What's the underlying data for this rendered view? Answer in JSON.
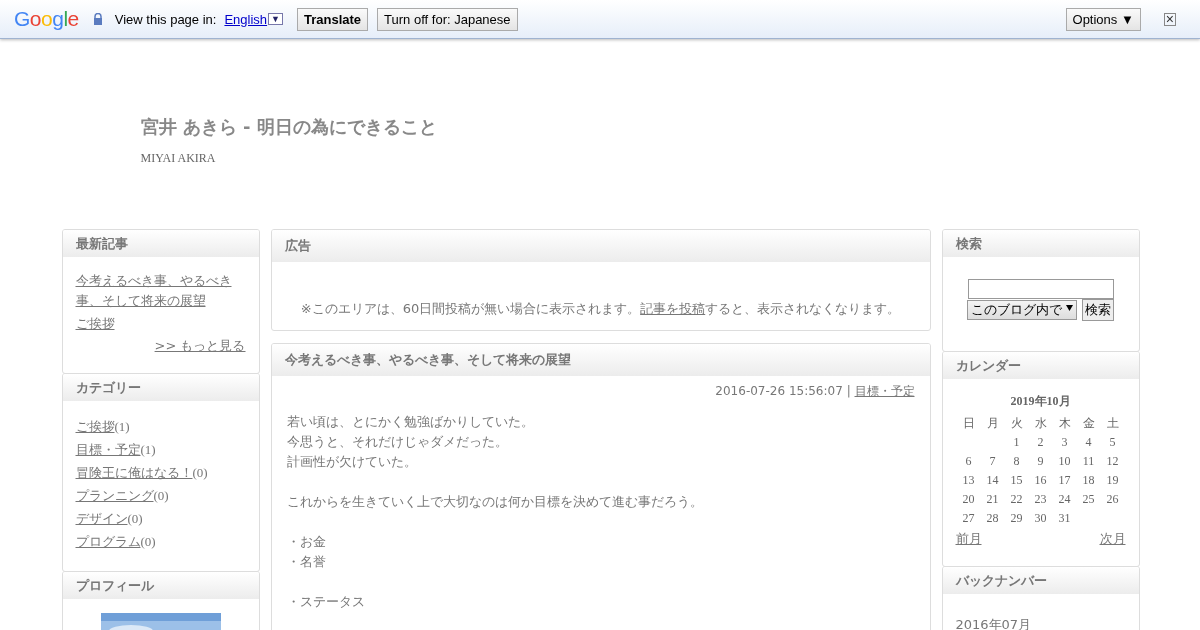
{
  "translate_bar": {
    "logo": "Google",
    "prompt": "View this page in:",
    "language": "English",
    "language_caret": "▼",
    "translate_button": "Translate",
    "turn_off_button": "Turn off for: Japanese",
    "options_button": "Options ▼",
    "close": "×"
  },
  "header": {
    "title": "宮井 あきら - 明日の為にできること",
    "subtitle": "MIYAI AKIRA"
  },
  "left_sidebar": {
    "recent": {
      "title": "最新記事",
      "items": [
        "今考えるべき事、やるべき事、そして将来の展望",
        "ご挨拶"
      ],
      "more": ">> もっと見る"
    },
    "categories": {
      "title": "カテゴリー",
      "items": [
        {
          "name": "ご挨拶",
          "count": "(1)"
        },
        {
          "name": "目標・予定",
          "count": "(1)"
        },
        {
          "name": "冒険王に俺はなる！",
          "count": "(0)"
        },
        {
          "name": "プランニング",
          "count": "(0)"
        },
        {
          "name": "デザイン",
          "count": "(0)"
        },
        {
          "name": "プログラム",
          "count": "(0)"
        }
      ]
    },
    "profile": {
      "title": "プロフィール"
    }
  },
  "ad": {
    "title": "広告",
    "text_before": "※このエリアは、60日間投稿が無い場合に表示されます。",
    "link": "記事を投稿",
    "text_after": "すると、表示されなくなります。"
  },
  "article": {
    "title": "今考えるべき事、やるべき事、そして将来の展望",
    "date": "2016-07-26 15:56:07",
    "separator": "|",
    "category": "目標・予定",
    "paragraphs": [
      [
        "若い頃は、とにかく勉強ばかりしていた。",
        "今思うと、それだけじゃダメだった。",
        "計画性が欠けていた。"
      ],
      [
        "これからを生きていく上で大切なのは何か目標を決めて進む事だろう。"
      ],
      [
        "・お金",
        "・名誉"
      ],
      [
        "・ステータス"
      ]
    ]
  },
  "right_sidebar": {
    "search": {
      "title": "検索",
      "scope": "このブログ内で",
      "search_button": "検索"
    },
    "calendar": {
      "title": "カレンダー",
      "month": "2019年10月",
      "weekdays": [
        "日",
        "月",
        "火",
        "水",
        "木",
        "金",
        "土"
      ],
      "weeks": [
        {
          "kind": "first",
          "days": [
            "1",
            "2",
            "3",
            "4",
            "5"
          ]
        },
        {
          "kind": "full",
          "days": [
            "6",
            "7",
            "8",
            "9",
            "10",
            "11",
            "12"
          ]
        },
        {
          "kind": "full",
          "days": [
            "13",
            "14",
            "15",
            "16",
            "17",
            "18",
            "19"
          ]
        },
        {
          "kind": "full",
          "days": [
            "20",
            "21",
            "22",
            "23",
            "24",
            "25",
            "26"
          ]
        },
        {
          "kind": "last",
          "days": [
            "27",
            "28",
            "29",
            "30",
            "31"
          ]
        }
      ],
      "prev": "前月",
      "next": "次月"
    },
    "backnumber": {
      "title": "バックナンバー",
      "items": [
        "2016年07月"
      ]
    }
  }
}
